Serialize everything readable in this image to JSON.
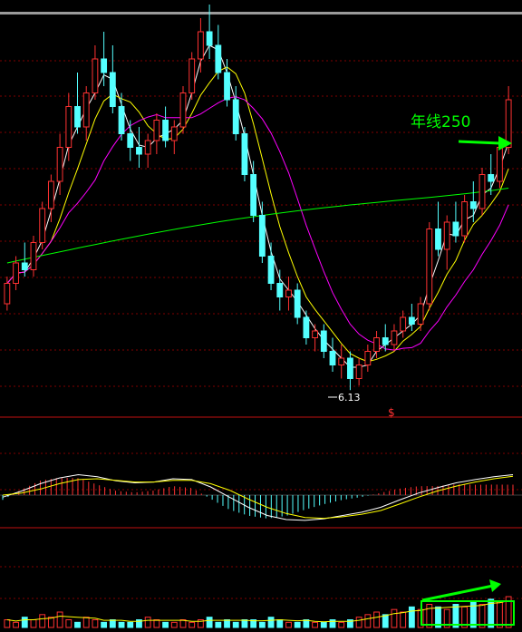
{
  "chart_data": [
    {
      "type": "candlestick",
      "panel": "price",
      "annotations": {
        "ma250_label": "年线250",
        "low_marker": "6.13",
        "divider_mark": "$"
      },
      "ohlc": [
        [
          7.4,
          7.8,
          7.3,
          7.7
        ],
        [
          7.7,
          8.1,
          7.6,
          8.0
        ],
        [
          8.0,
          8.3,
          7.8,
          7.9
        ],
        [
          7.9,
          8.4,
          7.8,
          8.3
        ],
        [
          8.3,
          8.9,
          8.2,
          8.8
        ],
        [
          8.8,
          9.3,
          8.6,
          9.2
        ],
        [
          9.2,
          9.9,
          9.0,
          9.7
        ],
        [
          9.7,
          10.5,
          9.5,
          10.3
        ],
        [
          10.3,
          10.8,
          9.9,
          10.0
        ],
        [
          10.0,
          10.6,
          9.8,
          10.5
        ],
        [
          10.5,
          11.2,
          10.4,
          11.0
        ],
        [
          11.0,
          11.4,
          10.6,
          10.8
        ],
        [
          10.8,
          11.2,
          10.2,
          10.3
        ],
        [
          10.3,
          10.5,
          9.8,
          9.9
        ],
        [
          9.9,
          10.1,
          9.5,
          9.7
        ],
        [
          9.7,
          10.0,
          9.4,
          9.6
        ],
        [
          9.6,
          9.9,
          9.4,
          9.8
        ],
        [
          9.8,
          10.2,
          9.6,
          10.1
        ],
        [
          10.1,
          10.3,
          9.7,
          9.8
        ],
        [
          9.8,
          10.1,
          9.6,
          10.0
        ],
        [
          10.0,
          10.6,
          9.9,
          10.5
        ],
        [
          10.5,
          11.1,
          10.4,
          11.0
        ],
        [
          11.0,
          11.6,
          10.8,
          11.4
        ],
        [
          11.4,
          11.8,
          11.0,
          11.2
        ],
        [
          11.2,
          11.5,
          10.7,
          10.8
        ],
        [
          10.8,
          11.0,
          10.3,
          10.4
        ],
        [
          10.4,
          10.6,
          9.8,
          9.9
        ],
        [
          9.9,
          10.0,
          9.2,
          9.3
        ],
        [
          9.3,
          9.5,
          8.6,
          8.7
        ],
        [
          8.7,
          8.9,
          8.0,
          8.1
        ],
        [
          8.1,
          8.3,
          7.6,
          7.7
        ],
        [
          7.7,
          7.9,
          7.3,
          7.5
        ],
        [
          7.5,
          7.8,
          7.3,
          7.6
        ],
        [
          7.6,
          7.7,
          7.1,
          7.2
        ],
        [
          7.2,
          7.3,
          6.8,
          6.9
        ],
        [
          6.9,
          7.1,
          6.7,
          7.0
        ],
        [
          7.0,
          7.1,
          6.6,
          6.7
        ],
        [
          6.7,
          6.9,
          6.4,
          6.5
        ],
        [
          6.5,
          6.8,
          6.3,
          6.6
        ],
        [
          6.6,
          6.7,
          6.13,
          6.3
        ],
        [
          6.3,
          6.6,
          6.2,
          6.5
        ],
        [
          6.5,
          6.8,
          6.4,
          6.7
        ],
        [
          6.7,
          7.0,
          6.6,
          6.9
        ],
        [
          6.9,
          7.1,
          6.7,
          6.8
        ],
        [
          6.8,
          7.1,
          6.7,
          7.0
        ],
        [
          7.0,
          7.3,
          6.9,
          7.2
        ],
        [
          7.2,
          7.4,
          7.0,
          7.1
        ],
        [
          7.1,
          7.5,
          7.0,
          7.4
        ],
        [
          7.4,
          8.6,
          7.3,
          8.5
        ],
        [
          8.5,
          8.9,
          8.1,
          8.2
        ],
        [
          8.2,
          8.7,
          7.9,
          8.6
        ],
        [
          8.6,
          8.9,
          8.3,
          8.4
        ],
        [
          8.4,
          9.0,
          8.3,
          8.9
        ],
        [
          8.9,
          9.2,
          8.6,
          8.8
        ],
        [
          8.8,
          9.4,
          8.7,
          9.3
        ],
        [
          9.3,
          9.6,
          9.0,
          9.2
        ],
        [
          9.2,
          9.8,
          9.1,
          9.7
        ],
        [
          9.7,
          10.6,
          9.6,
          10.4
        ]
      ]
    },
    {
      "type": "line",
      "panel": "macd",
      "series": [
        {
          "values": [
            -0.05,
            0.1,
            0.28,
            0.42,
            0.5,
            0.45,
            0.35,
            0.3,
            0.32,
            0.4,
            0.38,
            0.2,
            -0.05,
            -0.3,
            -0.5,
            -0.6,
            -0.62,
            -0.58,
            -0.5,
            -0.42,
            -0.3,
            -0.12,
            0.05,
            0.18,
            0.3,
            0.38,
            0.45,
            0.5
          ]
        },
        {
          "values": [
            0.0,
            0.05,
            0.15,
            0.28,
            0.38,
            0.4,
            0.36,
            0.32,
            0.32,
            0.36,
            0.36,
            0.28,
            0.12,
            -0.1,
            -0.3,
            -0.45,
            -0.55,
            -0.57,
            -0.53,
            -0.47,
            -0.38,
            -0.22,
            -0.05,
            0.1,
            0.22,
            0.32,
            0.4,
            0.46
          ]
        }
      ]
    },
    {
      "type": "bar",
      "panel": "volume",
      "values": [
        3,
        2,
        4,
        3,
        5,
        4,
        6,
        3,
        2,
        4,
        3,
        2,
        3,
        2,
        2,
        3,
        4,
        3,
        2,
        2,
        3,
        2,
        3,
        4,
        2,
        3,
        2,
        3,
        3,
        2,
        4,
        3,
        2,
        2,
        3,
        2,
        2,
        3,
        2,
        3,
        4,
        5,
        6,
        5,
        7,
        6,
        8,
        7,
        9,
        8,
        7,
        9,
        8,
        10,
        9,
        11,
        10,
        12
      ]
    }
  ],
  "colors": {
    "up": "#ff3232",
    "down": "#54ffff",
    "ma_short": "#ffffff",
    "ma_mid": "#ffff00",
    "ma_long": "#ff00ff",
    "ma250": "#00ff00",
    "grid": "#800000",
    "annotation": "#00ff00"
  }
}
